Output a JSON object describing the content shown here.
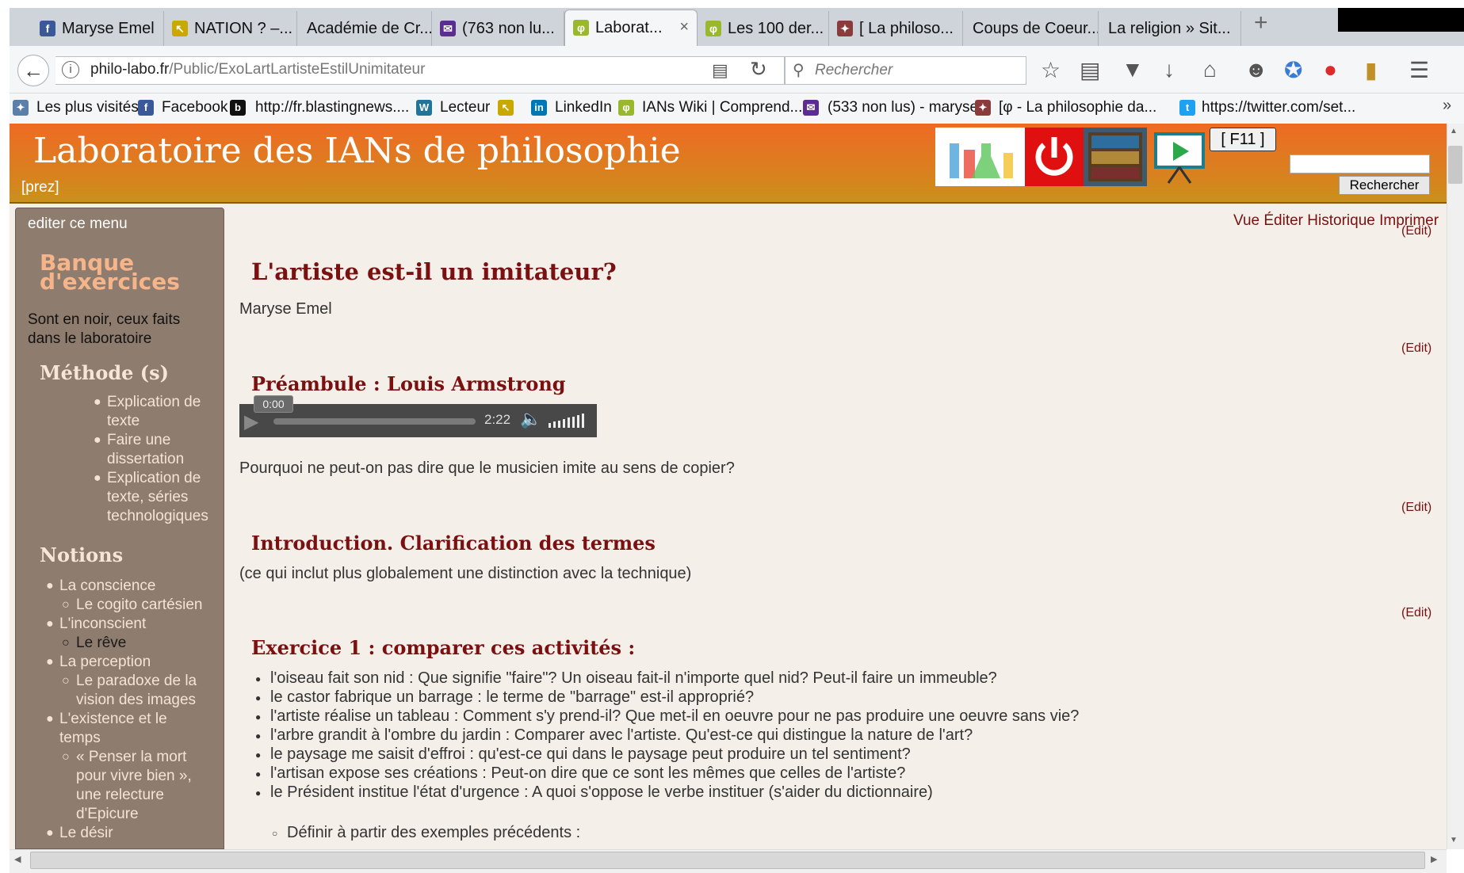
{
  "browser": {
    "tabs": [
      {
        "label": "Maryse Emel",
        "icon": "facebook-icon",
        "color": "#3b5998"
      },
      {
        "label": "NATION ? –...",
        "icon": "cursor-icon",
        "color": "#c9a800"
      },
      {
        "label": "Académie de Cr...",
        "icon": "",
        "color": ""
      },
      {
        "label": "(763 non lu...",
        "icon": "mail-icon",
        "color": "#5b2c91"
      },
      {
        "label": "Laborat...",
        "icon": "phi-icon",
        "color": "#9ab82e"
      },
      {
        "label": "Les 100 der...",
        "icon": "phi-icon",
        "color": "#9ab82e"
      },
      {
        "label": "[ La philoso...",
        "icon": "site-icon",
        "color": "#8a3b3b"
      },
      {
        "label": "Coups de Coeur...",
        "icon": "",
        "color": ""
      },
      {
        "label": "La religion » Sit...",
        "icon": "",
        "color": ""
      }
    ],
    "new_tab": "+",
    "close_glyph": "×",
    "url_host": "philo-labo.fr",
    "url_path": "/Public/ExoLartLartisteEstilUnimitateur",
    "search_placeholder": "Rechercher",
    "bookmarks": [
      {
        "label": "Les plus visités",
        "icon": "bookmarks-icon",
        "color": "#5b7fa8"
      },
      {
        "label": "Facebook",
        "icon": "facebook-icon",
        "color": "#3b5998"
      },
      {
        "label": "http://fr.blastingnews....",
        "icon": "blasting-icon",
        "color": "#111111"
      },
      {
        "label": "Lecteur",
        "icon": "wordpress-icon",
        "color": "#21759b"
      },
      {
        "label": "",
        "icon": "cursor-icon",
        "color": "#c9a800"
      },
      {
        "label": "LinkedIn",
        "icon": "linkedin-icon",
        "color": "#0077b5"
      },
      {
        "label": "IANs Wiki | Comprend...",
        "icon": "phi-icon",
        "color": "#9ab82e"
      },
      {
        "label": "(533 non lus) - maryse...",
        "icon": "mail-icon",
        "color": "#5b2c91"
      },
      {
        "label": "[φ - La philosophie da...",
        "icon": "site-icon",
        "color": "#8a3b3b"
      },
      {
        "label": "https://twitter.com/set...",
        "icon": "twitter-icon",
        "color": "#1da1f2"
      }
    ],
    "overflow": "»"
  },
  "site": {
    "title": "Laboratoire des IANs de philosophie",
    "prez": "[prez]",
    "f11": "[ F11 ]",
    "search_button": "Rechercher",
    "header_color": "#ef6a24"
  },
  "sidebar": {
    "edit_menu": "editer ce menu",
    "bank_title_1": "Banque",
    "bank_title_2": "d'exercices",
    "note_1": "Sont en noir, ceux faits",
    "note_2": "dans le laboratoire",
    "method_title": "Méthode (s)",
    "methods": [
      [
        "Explication de",
        "texte"
      ],
      [
        "Faire une",
        "dissertation"
      ],
      [
        "Explication de",
        "texte, séries",
        "technologiques"
      ]
    ],
    "notions_title": "Notions",
    "notions": [
      {
        "label": [
          "La conscience"
        ],
        "dark": false,
        "level": 1
      },
      {
        "label": [
          "Le cogito cartésien"
        ],
        "dark": false,
        "level": 2
      },
      {
        "label": [
          "L'inconscient"
        ],
        "dark": false,
        "level": 1
      },
      {
        "label": [
          "Le rêve"
        ],
        "dark": true,
        "level": 2
      },
      {
        "label": [
          "La perception"
        ],
        "dark": false,
        "level": 1
      },
      {
        "label": [
          "Le paradoxe de la",
          "vision des images"
        ],
        "dark": false,
        "level": 2
      },
      {
        "label": [
          "L'existence et le",
          "temps"
        ],
        "dark": false,
        "level": 1
      },
      {
        "label": [
          "« Penser la mort",
          "pour vivre bien »,",
          "une relecture",
          "d'Epicure"
        ],
        "dark": false,
        "level": 2
      },
      {
        "label": [
          "Le désir"
        ],
        "dark": false,
        "level": 1
      }
    ]
  },
  "content": {
    "actions": "Vue Éditer Historique Imprimer",
    "edit": "(Edit)",
    "title": "L'artiste est-il un imitateur?",
    "author": "Maryse Emel",
    "preamble_title": "Préambule : Louis Armstrong",
    "audio_current": "0:00",
    "audio_duration": "2:22",
    "preamble_question": "Pourquoi ne peut-on pas dire que le musicien imite au sens de copier?",
    "intro_title": "Introduction. Clarification des termes",
    "intro_text": "(ce qui inclut plus globalement une distinction avec la technique)",
    "ex1_title": "Exercice 1 : comparer ces activités :",
    "ex1_items": [
      "l'oiseau fait son nid : Que signifie \"faire\"? Un oiseau fait-il n'importe quel nid? Peut-il faire un immeuble?",
      "le castor fabrique un barrage : le terme de \"barrage\" est-il approprié?",
      "l'artiste réalise un tableau : Comment s'y prend-il? Que met-il en oeuvre pour ne pas produire une oeuvre sans vie?",
      "l'arbre grandit à l'ombre du jardin : Comparer avec l'artiste. Qu'est-ce qui distingue la nature de l'art?",
      "le paysage me saisit d'effroi : qu'est-ce qui dans le paysage peut produire un tel sentiment?",
      "l'artisan expose ses créations : Peut-on dire que ce sont les mêmes que celles de l'artiste?",
      "le Président institue l'état d'urgence : A quoi s'oppose le verbe instituer (s'aider du dictionnaire)"
    ],
    "ex1_sub": "Définir à partir des exemples précédents :"
  }
}
